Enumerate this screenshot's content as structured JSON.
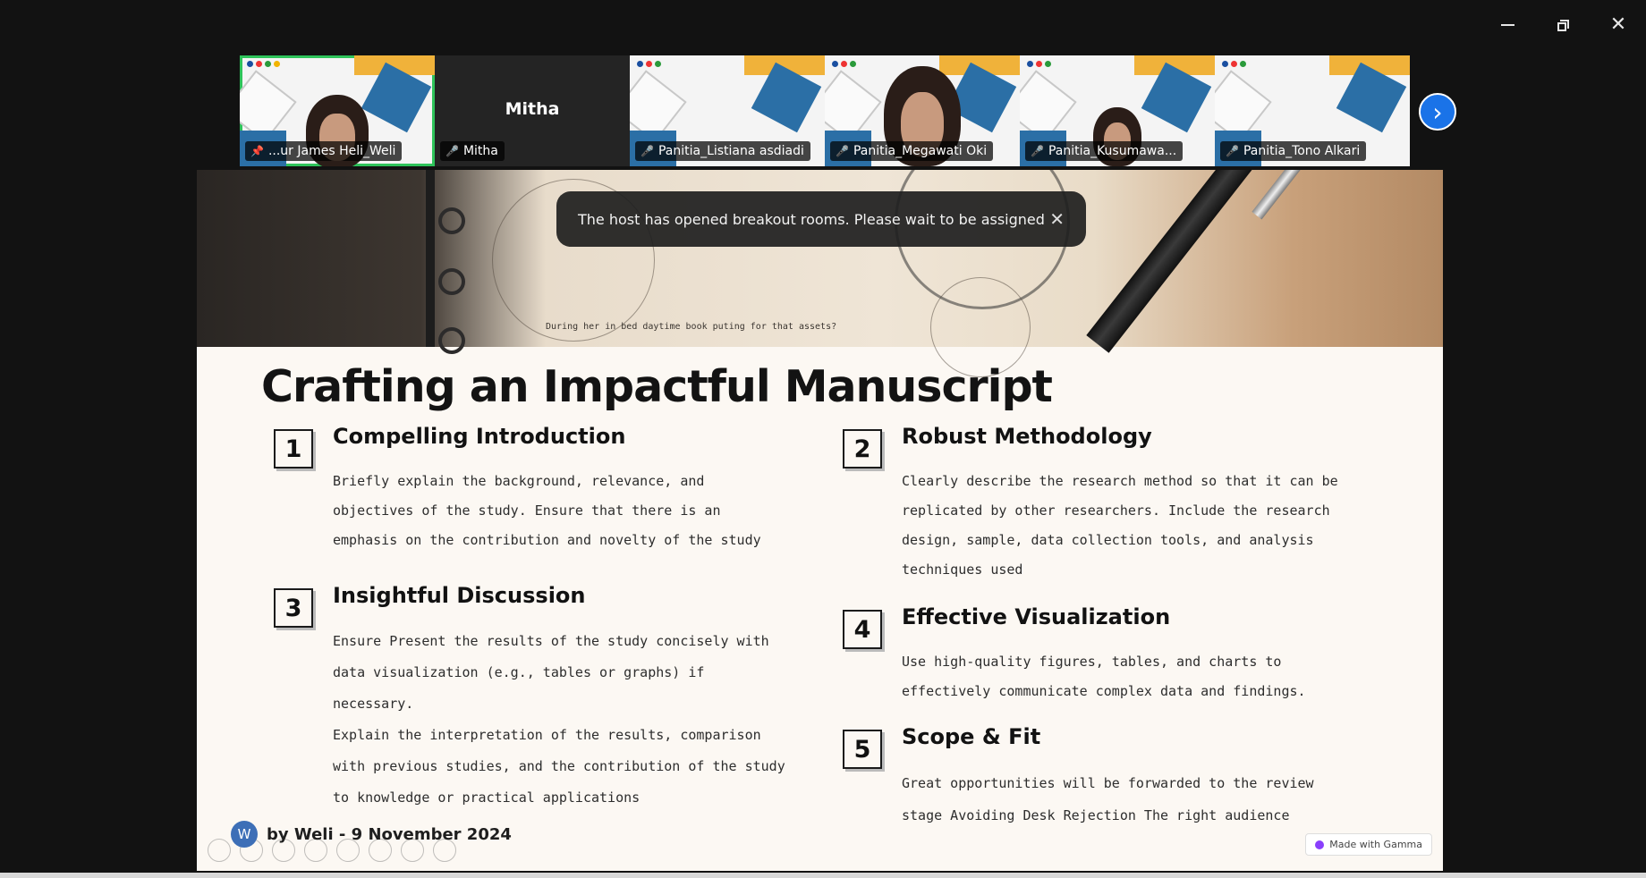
{
  "window": {
    "minimize_icon": "minimize-icon",
    "restore_icon": "restore-icon",
    "close_label": "✕"
  },
  "participants": [
    {
      "name": "...ur James Heli_Weli",
      "speaking": true,
      "video": "slide-face"
    },
    {
      "name": "Mitha",
      "display": "Mitha",
      "speaking": false,
      "video": "none"
    },
    {
      "name": "Panitia_Listiana asdiadi",
      "speaking": false,
      "video": "slide"
    },
    {
      "name": "Panitia_Megawati Oki",
      "speaking": false,
      "video": "slide-face"
    },
    {
      "name": "Panitia_Kusumawa...",
      "speaking": false,
      "video": "slide-face-small"
    },
    {
      "name": "Panitia_Tono Alkari",
      "speaking": false,
      "video": "slide"
    }
  ],
  "next_button_label": "›",
  "notification": {
    "text": "The host has opened breakout rooms. Please wait to be assigned",
    "close": "✕"
  },
  "slide": {
    "title": "Crafting an Impactful Manuscript",
    "hero_text": "During her in bed daytime book puting for that assets?",
    "items": [
      {
        "num": "1",
        "heading": "Compelling Introduction",
        "body": "Briefly explain the background, relevance, and\nobjectives of the study. Ensure that there is an\nemphasis on the contribution and novelty of the study"
      },
      {
        "num": "2",
        "heading": "Robust Methodology",
        "body": "Clearly describe the research method so that it can be\nreplicated by other researchers. Include the research\ndesign, sample, data collection tools, and analysis\ntechniques used"
      },
      {
        "num": "3",
        "heading": "Insightful Discussion",
        "body": "Ensure Present the results of the study concisely with\ndata visualization (e.g., tables or graphs) if\nnecessary.\nExplain the interpretation of the results, comparison\nwith previous studies, and the contribution of the study\nto knowledge or practical applications"
      },
      {
        "num": "4",
        "heading": "Effective Visualization",
        "body": "Use high-quality figures, tables, and charts to\neffectively communicate complex data and findings."
      },
      {
        "num": "5",
        "heading": "Scope & Fit",
        "body": "Great opportunities will be forwarded to the review\nstage Avoiding Desk Rejection The right audience"
      }
    ],
    "byline_initial": "W",
    "byline": "by Weli  - 9 November 2024",
    "badge": "Made with Gamma"
  }
}
